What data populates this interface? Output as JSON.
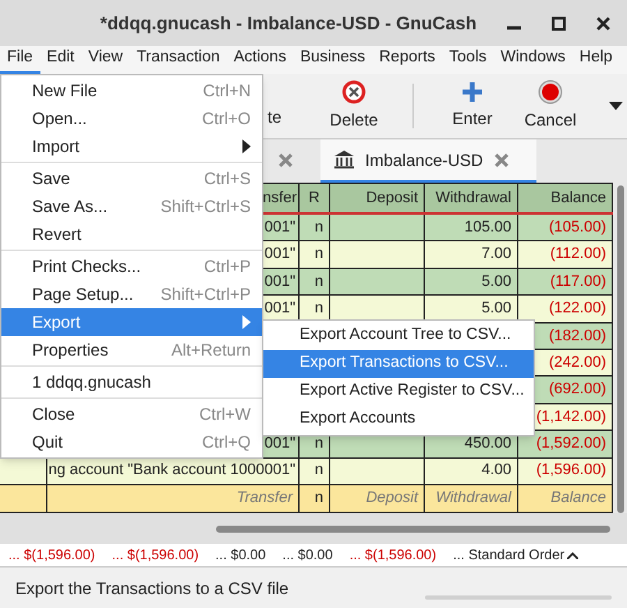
{
  "window": {
    "title": "*ddqq.gnucash - Imbalance-USD - GnuCash"
  },
  "menubar": [
    {
      "label": "File",
      "selected": true
    },
    {
      "label": "Edit",
      "selected": false
    },
    {
      "label": "View",
      "selected": false
    },
    {
      "label": "Transaction",
      "selected": false
    },
    {
      "label": "Actions",
      "selected": false
    },
    {
      "label": "Business",
      "selected": false
    },
    {
      "label": "Reports",
      "selected": false
    },
    {
      "label": "Tools",
      "selected": false
    },
    {
      "label": "Windows",
      "selected": false
    },
    {
      "label": "Help",
      "selected": false
    }
  ],
  "toolbar": {
    "cut_label": "te",
    "buttons": [
      {
        "label": "Delete",
        "kind": "delete"
      },
      {
        "label": "Enter",
        "kind": "enter"
      },
      {
        "label": "Cancel",
        "kind": "cancel"
      }
    ]
  },
  "tabs": [
    {
      "selected": false
    },
    {
      "label": "Imbalance-USD",
      "selected": true
    }
  ],
  "register": {
    "columns": [
      "nsfer",
      "R",
      "Deposit",
      "Withdrawal",
      "Balance"
    ],
    "rows": [
      {
        "transfer": "001\"",
        "r": "n",
        "withdrawal": "105.00",
        "balance": "(105.00)",
        "negative": true
      },
      {
        "transfer": "001\"",
        "r": "n",
        "withdrawal": "7.00",
        "balance": "(112.00)",
        "negative": true
      },
      {
        "transfer": "001\"",
        "r": "n",
        "withdrawal": "5.00",
        "balance": "(117.00)",
        "negative": true
      },
      {
        "transfer": "001\"",
        "r": "n",
        "withdrawal": "5.00",
        "balance": "(122.00)",
        "negative": true
      },
      {
        "balance": "(182.00)",
        "negative": true
      },
      {
        "balance": "(242.00)",
        "negative": true
      },
      {
        "balance": "(692.00)",
        "negative": true
      },
      {
        "balance": "(1,142.00)",
        "negative": true
      },
      {
        "transfer": "001\"",
        "r": "n",
        "withdrawal": "450.00",
        "balance": "(1,592.00)",
        "negative": true
      },
      {
        "transfer": "ng account \"Bank account 1000001\"",
        "r": "n",
        "withdrawal": "4.00",
        "balance": "(1,596.00)",
        "negative": true
      }
    ],
    "blank_row": {
      "transfer": "Transfer",
      "r": "n",
      "deposit": "Deposit",
      "withdrawal": "Withdrawal",
      "balance": "Balance"
    }
  },
  "summary": [
    {
      "text": "... $(1,596.00)",
      "negative": true
    },
    {
      "text": "... $(1,596.00)",
      "negative": true
    },
    {
      "text": "... $0.00",
      "negative": false
    },
    {
      "text": "... $0.00",
      "negative": false
    },
    {
      "text": "... $(1,596.00)",
      "negative": true
    },
    {
      "text": "... Standard Order",
      "negative": false
    }
  ],
  "file_menu": [
    {
      "kind": "item",
      "label": "New File",
      "shortcut": "Ctrl+N",
      "selected": false
    },
    {
      "kind": "item",
      "label": "Open...",
      "shortcut": "Ctrl+O",
      "selected": false
    },
    {
      "kind": "submenu",
      "label": "Import",
      "selected": false
    },
    {
      "kind": "separator"
    },
    {
      "kind": "item",
      "label": "Save",
      "shortcut": "Ctrl+S",
      "selected": false
    },
    {
      "kind": "item",
      "label": "Save As...",
      "shortcut": "Shift+Ctrl+S",
      "selected": false
    },
    {
      "kind": "item",
      "label": "Revert",
      "selected": false
    },
    {
      "kind": "separator"
    },
    {
      "kind": "item",
      "label": "Print Checks...",
      "shortcut": "Ctrl+P",
      "selected": false
    },
    {
      "kind": "item",
      "label": "Page Setup...",
      "shortcut": "Shift+Ctrl+P",
      "selected": false
    },
    {
      "kind": "submenu",
      "label": "Export",
      "selected": true
    },
    {
      "kind": "item",
      "label": "Properties",
      "shortcut": "Alt+Return",
      "selected": false
    },
    {
      "kind": "separator"
    },
    {
      "kind": "item",
      "label": "1 ddqq.gnucash",
      "selected": false
    },
    {
      "kind": "separator"
    },
    {
      "kind": "item",
      "label": "Close",
      "shortcut": "Ctrl+W",
      "selected": false
    },
    {
      "kind": "item",
      "label": "Quit",
      "shortcut": "Ctrl+Q",
      "selected": false
    }
  ],
  "export_submenu": [
    {
      "label": "Export Account Tree to CSV...",
      "selected": false
    },
    {
      "label": "Export Transactions to CSV...",
      "selected": true
    },
    {
      "label": "Export Active Register to CSV...",
      "selected": false
    },
    {
      "label": "Export Accounts",
      "selected": false
    }
  ],
  "status_bar": {
    "text": "Export the Transactions to a CSV file",
    "level": 0
  }
}
